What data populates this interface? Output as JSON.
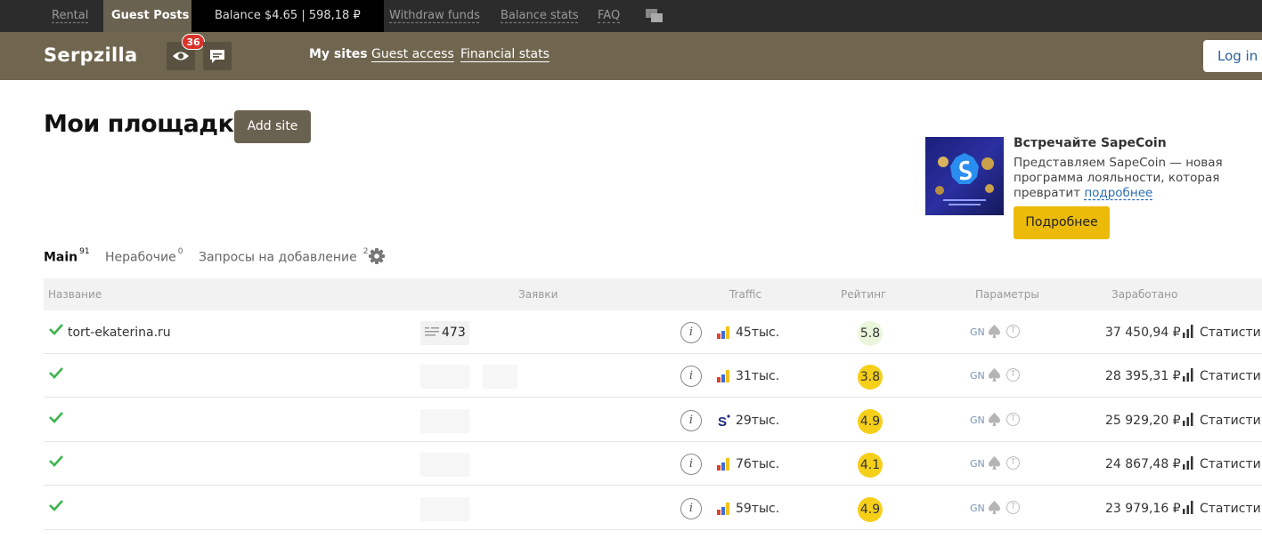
{
  "topbar": {
    "rental": "Rental",
    "guest_posts": "Guest Posts",
    "balance": "Balance $4.65 | 598,18 ₽",
    "withdraw": "Withdraw funds",
    "balance_stats": "Balance stats",
    "faq": "FAQ"
  },
  "header": {
    "logo": "Serpzilla",
    "badge_count": "36",
    "nav": [
      "My sites",
      "Guest access",
      "Financial stats"
    ],
    "login": "Log in a"
  },
  "page": {
    "title": "Мои площадки",
    "add_site": "Add site"
  },
  "promo": {
    "title": "Встречайте SapeCoin",
    "text": "Представляем SapeCoin — новая программа лояльности, которая превратит",
    "link": "подробнее",
    "button": "Подробнее"
  },
  "tabs": [
    {
      "label": "Main",
      "count": "91"
    },
    {
      "label": "Нерабочие",
      "count": "0"
    },
    {
      "label": "Запросы на добавление",
      "count": "2"
    }
  ],
  "table": {
    "headers": [
      "Название",
      "Заявки",
      "Traffic",
      "Рейтинг",
      "Параметры",
      "Заработано"
    ],
    "rows": [
      {
        "site": "tort-ekaterina.ru",
        "requests": "473",
        "traffic": "45тыс.",
        "source": "ym",
        "rating": "5.8",
        "rating_color": "#eaf6dc",
        "gn": "GN",
        "earned": "37 450,94 ₽",
        "stat": "Статистика"
      },
      {
        "site": "",
        "requests": "",
        "traffic": "31тыс.",
        "source": "ym",
        "rating": "3.8",
        "rating_color": "#f6cf19",
        "gn": "GN",
        "earned": "28 395,31 ₽",
        "stat": "Статистика"
      },
      {
        "site": "",
        "requests": "",
        "traffic": "29тыс.",
        "source": "s",
        "rating": "4.9",
        "rating_color": "#f6cf19",
        "gn": "GN",
        "earned": "25 929,20 ₽",
        "stat": "Статистика"
      },
      {
        "site": "",
        "requests": "",
        "traffic": "76тыс.",
        "source": "ym",
        "rating": "4.1",
        "rating_color": "#f6cf19",
        "gn": "GN",
        "earned": "24 867,48 ₽",
        "stat": "Статистика"
      },
      {
        "site": "",
        "requests": "",
        "traffic": "59тыс.",
        "source": "ym",
        "rating": "4.9",
        "rating_color": "#f6cf19",
        "gn": "GN",
        "earned": "23 979,16 ₽",
        "stat": "Статистика"
      }
    ]
  },
  "colors": {
    "topbar": "#2c2c2c",
    "header": "#70664f",
    "accent_yellow": "#ecbb0a",
    "check_green": "#3cb44b"
  }
}
